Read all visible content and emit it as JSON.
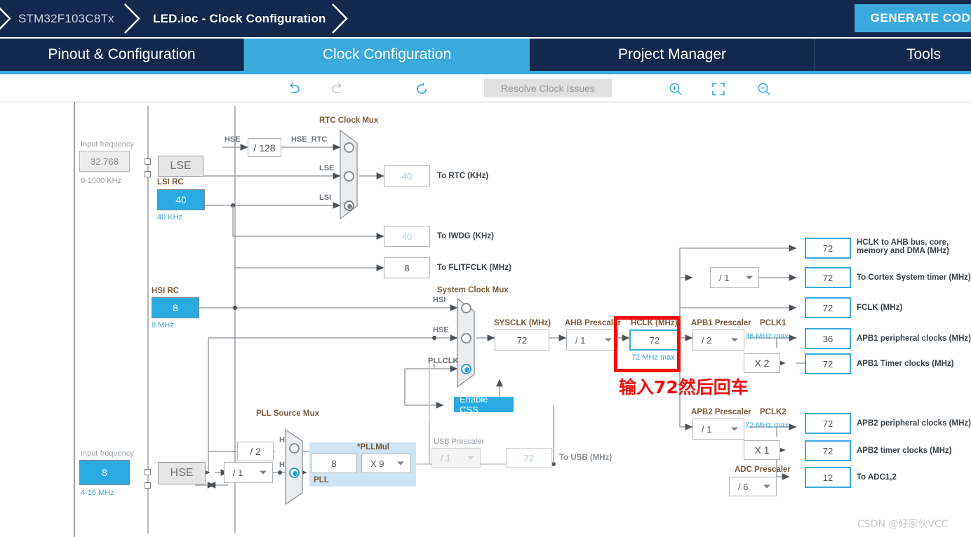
{
  "window": {
    "breadcrumb": [
      {
        "label": "STM32F103C8Tx",
        "strong": false
      },
      {
        "label": "LED.ioc - Clock Configuration",
        "strong": true
      }
    ],
    "generate_code_label": "GENERATE CODE",
    "accent_blue": "#3aa9dc",
    "header_navy": "#12284c"
  },
  "tabs": [
    {
      "label": "Pinout & Configuration",
      "active": false
    },
    {
      "label": "Clock Configuration",
      "active": true
    },
    {
      "label": "Project Manager",
      "active": false
    },
    {
      "label": "Tools",
      "active": false
    }
  ],
  "toolbar": {
    "undo": "undo-icon",
    "redo": "redo-icon",
    "reset": "reset-icon",
    "resolve_label": "Resolve Clock Issues",
    "zoom_in": "zoom-in-icon",
    "fit": "fit-to-screen-icon",
    "zoom_out": "zoom-out-icon"
  },
  "diagram": {
    "lse": {
      "input_frequency_label": "Input frequency",
      "input_frequency_value": "32.768",
      "range_label": "0-1000 KHz",
      "source_label": "LSE"
    },
    "lsi": {
      "title": "LSI RC",
      "value": "40",
      "unit_label": "40 KHz"
    },
    "hse_div128": {
      "label": "/ 128",
      "signal_in": "HSE",
      "signal_out": "HSE_RTC"
    },
    "rtc_mux": {
      "title": "RTC Clock Mux",
      "inputs": [
        "HSE_RTC",
        "LSE",
        "LSI"
      ],
      "selected_index": 2
    },
    "to_rtc": {
      "value": "40",
      "label": "To RTC (KHz)"
    },
    "to_iwdg": {
      "value": "40",
      "label": "To IWDG (KHz)"
    },
    "to_flitfclk": {
      "value": "8",
      "label": "To FLITFCLK (MHz)"
    },
    "hsi": {
      "title": "HSI RC",
      "value": "8",
      "unit_label": "8 MHz"
    },
    "hse": {
      "input_frequency_label": "Input frequency",
      "input_frequency_value": "8",
      "range_label": "4-16 MHz",
      "source_label": "HSE"
    },
    "hse_prediv": {
      "value": "/ 1"
    },
    "hsi_div2": {
      "label": "/ 2"
    },
    "pll_source_mux": {
      "title": "PLL Source Mux",
      "inputs": [
        "HSI",
        "HSE"
      ],
      "selected_index": 1
    },
    "pll": {
      "panel_label": "PLL",
      "input_value": "8",
      "mul_label": "*PLLMul",
      "mul_value": "X 9"
    },
    "system_clock_mux": {
      "title": "System Clock Mux",
      "inputs": [
        "HSI",
        "HSE",
        "PLLCLK"
      ],
      "selected_index": 2
    },
    "enable_css": {
      "label": "Enable CSS"
    },
    "usb_prescaler": {
      "title": "USB Prescaler",
      "value": "/ 1"
    },
    "to_usb": {
      "value": "72",
      "label": "To USB (MHz)"
    },
    "sysclk": {
      "title": "SYSCLK (MHz)",
      "value": "72"
    },
    "ahb_prescaler": {
      "title": "AHB Prescaler",
      "value": "/ 1"
    },
    "hclk": {
      "title": "HCLK (MHz)",
      "value": "72",
      "max_label": "72 MHz max"
    },
    "cortex_prescaler": {
      "value": "/ 1"
    },
    "apb1_prescaler": {
      "title": "APB1 Prescaler",
      "value": "/ 2",
      "pclk_label": "PCLK1",
      "max_label": "36 MHz max",
      "timer_mul": "X 2"
    },
    "apb2_prescaler": {
      "title": "APB2 Prescaler",
      "value": "/ 1",
      "pclk_label": "PCLK2",
      "max_label": "72 MHz max",
      "timer_mul": "X 1"
    },
    "adc_prescaler": {
      "title": "ADC Prescaler",
      "value": "/ 6"
    },
    "outputs": [
      {
        "value": "72",
        "label": "HCLK to AHB bus, core,\nmemory and DMA (MHz)"
      },
      {
        "value": "72",
        "label": "To Cortex System timer (MHz)"
      },
      {
        "value": "72",
        "label": "FCLK (MHz)"
      },
      {
        "value": "36",
        "label": "APB1 peripheral clocks (MHz)"
      },
      {
        "value": "72",
        "label": "APB1 Timer clocks (MHz)"
      },
      {
        "value": "72",
        "label": "APB2 peripheral clocks (MHz)"
      },
      {
        "value": "72",
        "label": "APB2 timer clocks (MHz)"
      },
      {
        "value": "12",
        "label": "To ADC1,2"
      }
    ]
  },
  "annotation": {
    "text": "输入72然后回车",
    "color": "#f40d0d"
  },
  "watermark": {
    "text": "CSDN @好家伙VCC"
  }
}
